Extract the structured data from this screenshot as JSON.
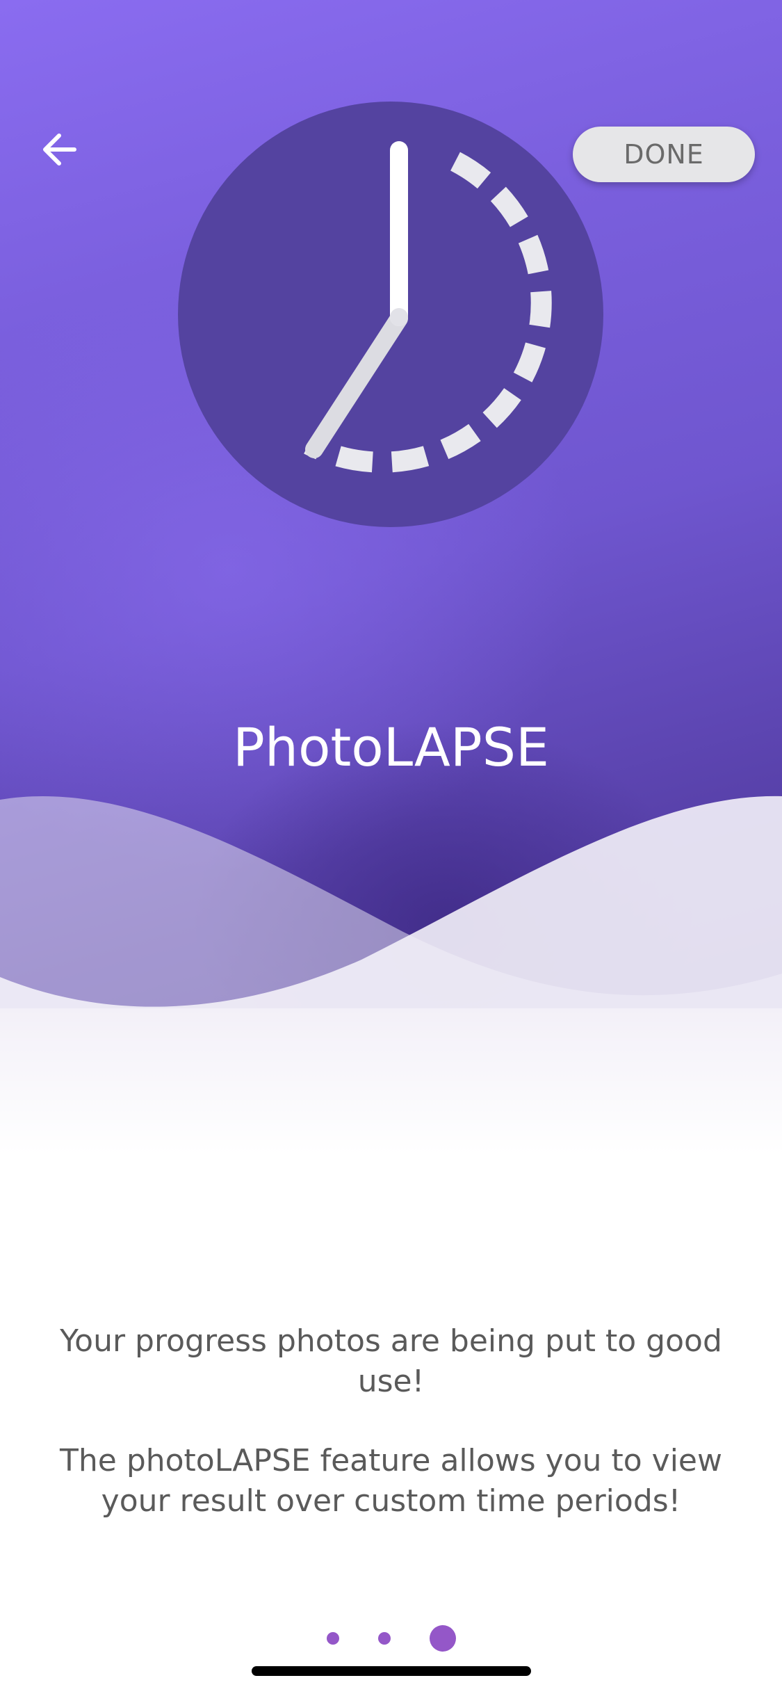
{
  "header": {
    "back_icon": "arrow-left-icon",
    "done_label": "DONE"
  },
  "hero": {
    "illustration_icon": "clock-icon",
    "title": "PhotoLAPSE"
  },
  "description": {
    "paragraph_1": "Your progress photos are being put to good use!",
    "paragraph_2": "The photoLAPSE feature allows you to view your result over custom time periods!"
  },
  "pager": {
    "page_count": 3,
    "current_page": 3
  },
  "colors": {
    "accent": "#9457c8",
    "hero_purple": "#7a5fdd",
    "clock_face": "#5443a0",
    "done_button_bg": "#e6e6e8"
  }
}
